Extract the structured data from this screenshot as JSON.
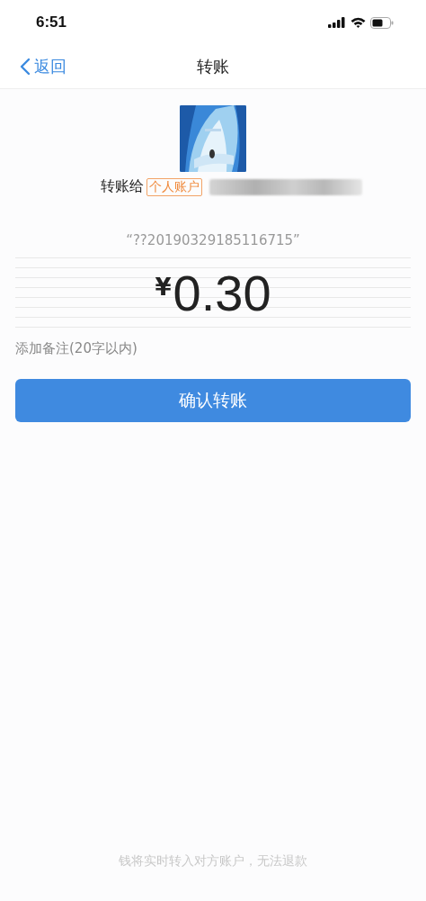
{
  "status_bar": {
    "time": "6:51"
  },
  "nav": {
    "back": "返回",
    "title": "转账"
  },
  "recipient": {
    "prefix": "转账给",
    "account_tag": "个人账户",
    "name_redacted": true
  },
  "memo_quote": "“??20190329185116715”",
  "amount": {
    "currency": "¥",
    "value": "0.30"
  },
  "note": {
    "placeholder": "添加备注(20字以内)"
  },
  "confirm_button": "确认转账",
  "footer_notice": "钱将实时转入对方账户，无法退款"
}
